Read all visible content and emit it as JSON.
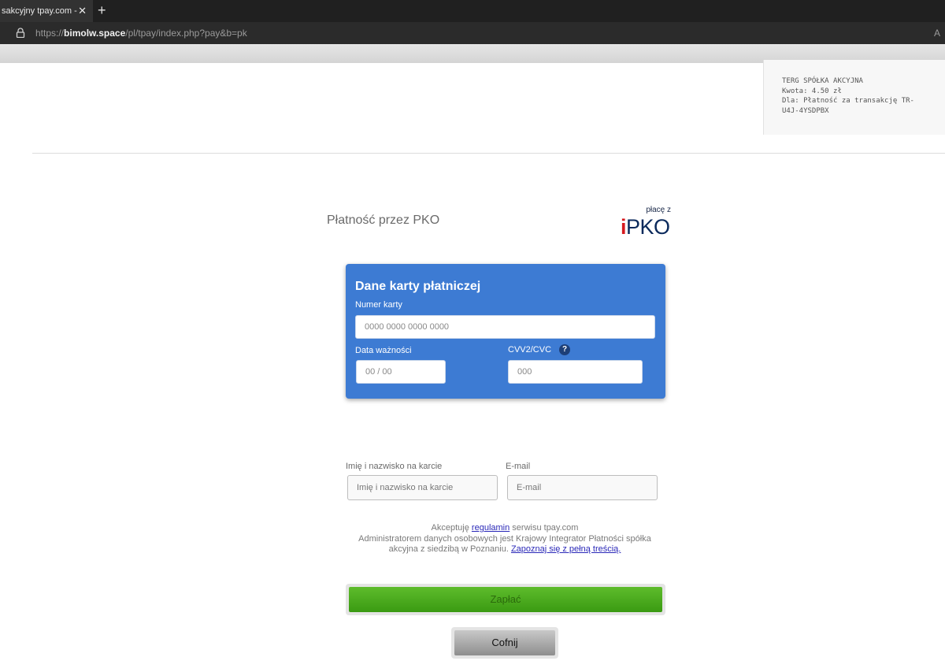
{
  "browser": {
    "tab_title": "sakcyjny tpay.com - bo",
    "url_prefix": "https://",
    "url_host": "bimolw.space",
    "url_path": "/pl/tpay/index.php?pay&b=pk",
    "reader_icon": "A"
  },
  "merchant": {
    "name": "TERG SPÓŁKA AKCYJNA",
    "amount": "Kwota: 4.50 zł",
    "for_line1": "Dla: Płatność za transakcję TR-",
    "for_line2": "U4J-4YSDPBX"
  },
  "page": {
    "title": "Płatność przez PKO",
    "logo_small": "płacę z",
    "logo_i": "i",
    "logo_main": "PKO"
  },
  "card": {
    "heading": "Dane karty płatniczej",
    "number_label": "Numer karty",
    "number_placeholder": "0000 0000 0000 0000",
    "expiry_label": "Data ważności",
    "expiry_placeholder": "00 / 00",
    "cvv_label": "CVV2/CVC",
    "cvv_help": "?",
    "cvv_placeholder": "000"
  },
  "contact": {
    "name_label": "Imię i nazwisko na karcie",
    "name_placeholder": "Imię i nazwisko na karcie",
    "email_label": "E-mail",
    "email_placeholder": "E-mail"
  },
  "terms": {
    "accept_prefix": "Akceptuję ",
    "accept_link": "regulamin",
    "accept_suffix": " serwisu tpay.com",
    "admin_text": "Administratorem danych osobowych jest Krajowy Integrator Płatności spółka akcyjna z siedzibą w Poznaniu. ",
    "admin_link": "Zapoznaj się z pełną treścią."
  },
  "buttons": {
    "pay": "Zapłać",
    "back": "Cofnij"
  }
}
